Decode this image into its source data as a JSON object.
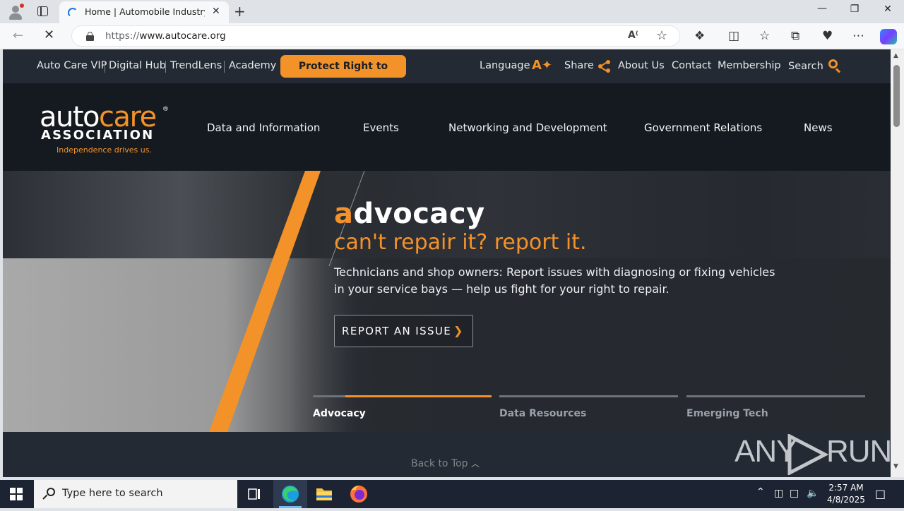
{
  "browser": {
    "tab_title": "Home | Automobile Industry Ass...",
    "url_prefix": "https://",
    "url_host": "www.autocare.org",
    "new_tab_glyph": "+",
    "close_glyph": "✕"
  },
  "utility_nav": {
    "left_links": [
      "Auto Care VIP",
      "Digital Hub",
      "TrendLens",
      "Academy"
    ],
    "cta": "Protect Right to Repair",
    "language": "Language",
    "share": "Share",
    "about": "About Us",
    "contact": "Contact",
    "membership": "Membership",
    "search": "Search"
  },
  "logo": {
    "word_a": "auto",
    "word_b": "care",
    "registered": "®",
    "association": "ASSOCIATION",
    "tagline": "Independence drives us."
  },
  "main_nav": {
    "items": [
      "Data and Information",
      "Events",
      "Networking and Development",
      "Government Relations",
      "News"
    ]
  },
  "hero": {
    "heading_first": "a",
    "heading_rest": "dvocacy",
    "subheading": "can't repair it? report it.",
    "body": "Technicians and shop owners: Report issues with diagnosing or fixing vehicles in your service bays — help us fight for your right to repair.",
    "button": "REPORT AN ISSUE",
    "button_chevron": "❯",
    "slides": [
      {
        "label": "Advocacy",
        "progress": 1.0,
        "active": true
      },
      {
        "label": "Data Resources",
        "progress": 0,
        "active": false
      },
      {
        "label": "Emerging Tech",
        "progress": 0,
        "active": false
      }
    ]
  },
  "footer": {
    "back_to_top": "Back to Top"
  },
  "watermark": {
    "left": "ANY",
    "right": "RUN"
  },
  "taskbar": {
    "search_placeholder": "Type here to search",
    "time": "2:57 AM",
    "date": "4/8/2025"
  },
  "colors": {
    "accent": "#f4922a",
    "utility_bg": "#232a33",
    "nav_bg": "#151a20",
    "taskbar_bg": "#1c2433"
  }
}
